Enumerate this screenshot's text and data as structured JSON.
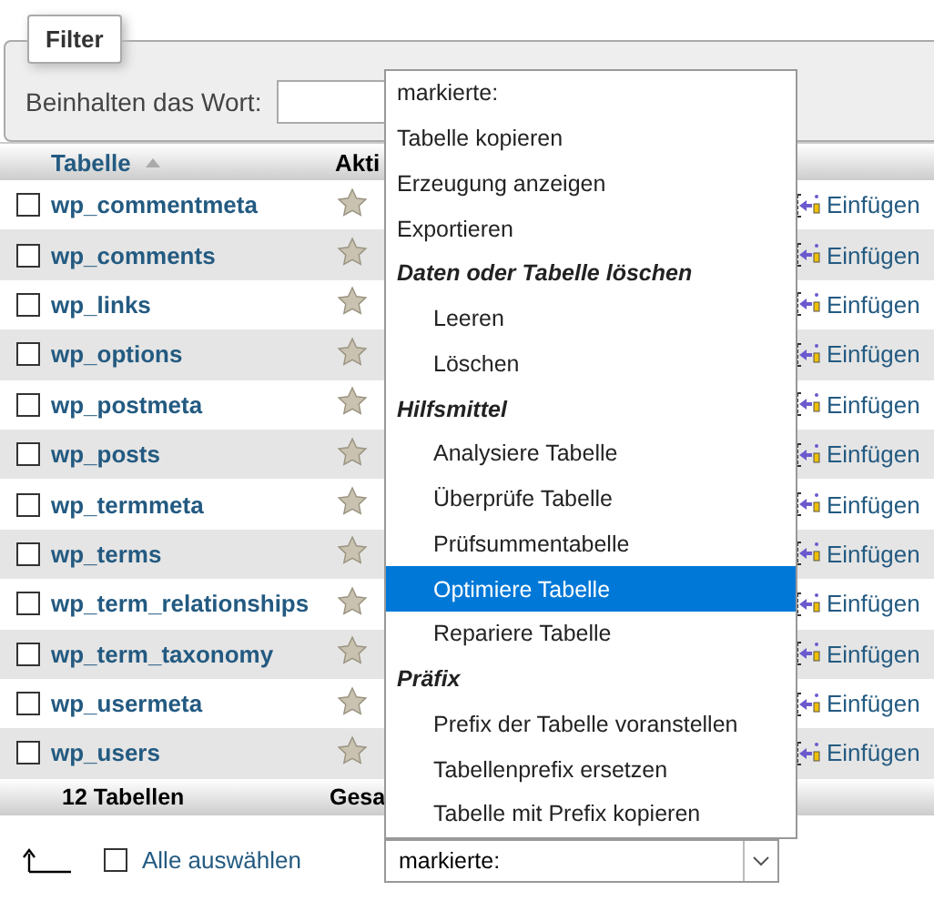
{
  "filter": {
    "legend": "Filter",
    "label": "Beinhalten das Wort:"
  },
  "table": {
    "columns": [
      {
        "label": "Tabelle",
        "sorted": true
      },
      {
        "label": "Akti"
      }
    ],
    "rows": [
      {
        "name": "wp_commentmeta",
        "checked": false,
        "action": "Einfügen"
      },
      {
        "name": "wp_comments",
        "checked": false,
        "action": "Einfügen"
      },
      {
        "name": "wp_links",
        "checked": false,
        "action": "Einfügen"
      },
      {
        "name": "wp_options",
        "checked": false,
        "action": "Einfügen"
      },
      {
        "name": "wp_postmeta",
        "checked": false,
        "action": "Einfügen"
      },
      {
        "name": "wp_posts",
        "checked": false,
        "action": "Einfügen"
      },
      {
        "name": "wp_termmeta",
        "checked": false,
        "action": "Einfügen"
      },
      {
        "name": "wp_terms",
        "checked": false,
        "action": "Einfügen"
      },
      {
        "name": "wp_term_relationships",
        "checked": false,
        "action": "Einfügen"
      },
      {
        "name": "wp_term_taxonomy",
        "checked": false,
        "action": "Einfügen"
      },
      {
        "name": "wp_usermeta",
        "checked": false,
        "action": "Einfügen"
      },
      {
        "name": "wp_users",
        "checked": false,
        "action": "Einfügen"
      }
    ],
    "footer": {
      "count": "12 Tabellen",
      "column_2": "Gesa"
    }
  },
  "dropdown": {
    "items": [
      {
        "kind": "option",
        "label": "markierte:",
        "selected": false
      },
      {
        "kind": "option",
        "label": "Tabelle kopieren",
        "selected": false
      },
      {
        "kind": "option",
        "label": "Erzeugung anzeigen",
        "selected": false
      },
      {
        "kind": "option",
        "label": "Exportieren",
        "selected": false
      },
      {
        "kind": "group",
        "label": "Daten oder Tabelle löschen"
      },
      {
        "kind": "sub",
        "label": "Leeren",
        "selected": false
      },
      {
        "kind": "sub",
        "label": "Löschen",
        "selected": false
      },
      {
        "kind": "group",
        "label": "Hilfsmittel"
      },
      {
        "kind": "sub",
        "label": "Analysiere Tabelle",
        "selected": false
      },
      {
        "kind": "sub",
        "label": "Überprüfe Tabelle",
        "selected": false
      },
      {
        "kind": "sub",
        "label": "Prüfsummentabelle",
        "selected": false
      },
      {
        "kind": "sub",
        "label": "Optimiere Tabelle",
        "selected": true
      },
      {
        "kind": "sub",
        "label": "Repariere Tabelle",
        "selected": false
      },
      {
        "kind": "group",
        "label": "Präfix"
      },
      {
        "kind": "sub",
        "label": "Prefix der Tabelle voranstellen",
        "selected": false
      },
      {
        "kind": "sub",
        "label": "Tabellenprefix ersetzen",
        "selected": false
      },
      {
        "kind": "sub",
        "label": "Tabelle mit Prefix kopieren",
        "selected": false
      }
    ]
  },
  "select": {
    "value": "markierte:"
  },
  "select_all": {
    "label": "Alle auswählen",
    "checked": false
  }
}
